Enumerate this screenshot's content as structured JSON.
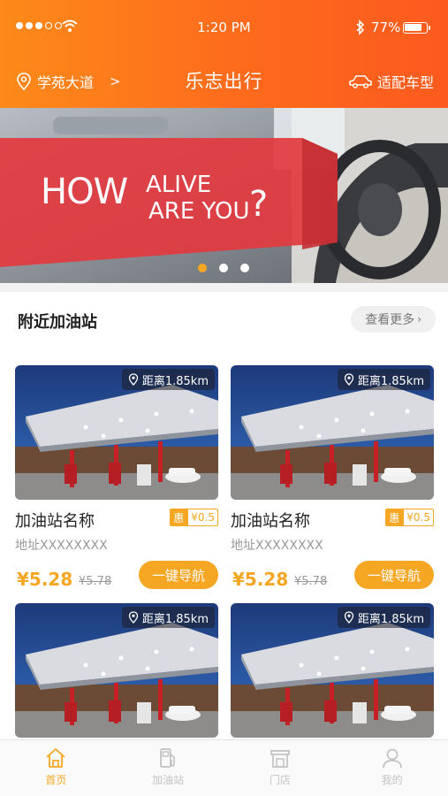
{
  "status_bar": {
    "time": "1:20 PM",
    "battery": "77%"
  },
  "header": {
    "location": "学苑大道",
    "location_arrow": ">",
    "title": "乐志出行",
    "car_label": "适配车型"
  },
  "banner": {
    "line1": "HOW",
    "line2": "ALIVE",
    "line3": "ARE YOU",
    "mark": "?",
    "active_dot": 0
  },
  "section": {
    "title": "附近加油站",
    "more": "查看更多"
  },
  "stations": [
    {
      "distance": "距离1.85km",
      "name": "加油站名称",
      "promo_tag": "惠",
      "promo_amount": "¥0.5",
      "address": "地址XXXXXXXX",
      "price": "¥5.28",
      "old_price": "¥5.78",
      "nav_button": "一键导航"
    },
    {
      "distance": "距离1.85km",
      "name": "加油站名称",
      "promo_tag": "惠",
      "promo_amount": "¥0.5",
      "address": "地址XXXXXXXX",
      "price": "¥5.28",
      "old_price": "¥5.78",
      "nav_button": "一键导航"
    },
    {
      "distance": "距离1.85km"
    },
    {
      "distance": "距离1.85km"
    }
  ],
  "tabbar": [
    {
      "label": "首页",
      "icon": "home-icon",
      "active": true
    },
    {
      "label": "加油站",
      "icon": "fuel-pump-icon",
      "active": false
    },
    {
      "label": "门店",
      "icon": "store-icon",
      "active": false
    },
    {
      "label": "我的",
      "icon": "user-icon",
      "active": false
    }
  ],
  "colors": {
    "accent": "#f5a623",
    "header_start": "#fd8a1a",
    "header_end": "#fc5a1e"
  }
}
